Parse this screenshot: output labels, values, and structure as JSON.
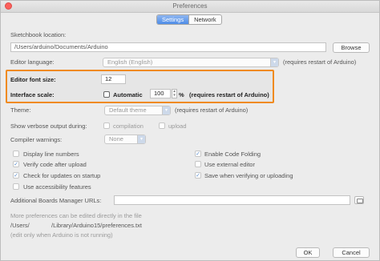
{
  "window": {
    "title": "Preferences"
  },
  "tabs": [
    {
      "label": "Settings"
    },
    {
      "label": "Network"
    }
  ],
  "sketchbook": {
    "label": "Sketchbook location:",
    "value": "/Users/arduino/Documents/Arduino",
    "browse_label": "Browse"
  },
  "editor_language": {
    "label": "Editor language:",
    "value": "English (English)",
    "note": "(requires restart of Arduino)"
  },
  "font_size": {
    "label": "Editor font size:",
    "value": "12"
  },
  "interface_scale": {
    "label": "Interface scale:",
    "automatic_label": "Automatic",
    "value": "100",
    "unit": "%",
    "note": "(requires restart of Arduino)"
  },
  "theme": {
    "label": "Theme:",
    "value": "Default theme",
    "note": "(requires restart of Arduino)"
  },
  "verbose": {
    "label": "Show verbose output during:",
    "compilation_label": "compilation",
    "upload_label": "upload"
  },
  "warnings": {
    "label": "Compiler warnings:",
    "value": "None"
  },
  "options": {
    "display_line_numbers": "Display line numbers",
    "enable_code_folding": "Enable Code Folding",
    "verify_after_upload": "Verify code after upload",
    "use_external_editor": "Use external editor",
    "check_updates": "Check for updates on startup",
    "save_when_verifying": "Save when verifying or uploading",
    "accessibility": "Use accessibility features"
  },
  "boards_manager": {
    "label": "Additional Boards Manager URLs:",
    "value": ""
  },
  "footer": {
    "line1": "More preferences can be edited directly in the file",
    "path_prefix": "/Users/",
    "path_suffix": "/Library/Arduino15/preferences.txt",
    "line3": "(edit only when Arduino is not running)"
  },
  "buttons": {
    "ok": "OK",
    "cancel": "Cancel"
  },
  "colors": {
    "accent": "#f08a1c",
    "tab_active": "#4e8de8",
    "check": "#5d8fce"
  }
}
